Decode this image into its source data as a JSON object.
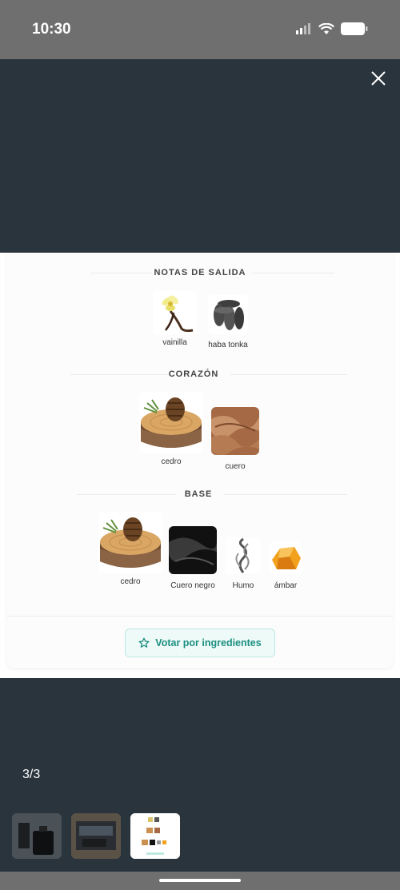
{
  "status": {
    "time": "10:30"
  },
  "card": {
    "sections": [
      {
        "title": "NOTAS DE SALIDA",
        "notes": [
          {
            "label": "vainilla"
          },
          {
            "label": "haba tonka"
          }
        ]
      },
      {
        "title": "CORAZÓN",
        "notes": [
          {
            "label": "cedro"
          },
          {
            "label": "cuero"
          }
        ]
      },
      {
        "title": "BASE",
        "notes": [
          {
            "label": "cedro"
          },
          {
            "label": "Cuero negro"
          },
          {
            "label": "Humo"
          },
          {
            "label": "ámbar"
          }
        ]
      }
    ],
    "vote_button_label": "Votar por ingredientes"
  },
  "gallery": {
    "counter": "3/3"
  },
  "colors": {
    "accent": "#1a8f80",
    "background": "#2a343d"
  }
}
